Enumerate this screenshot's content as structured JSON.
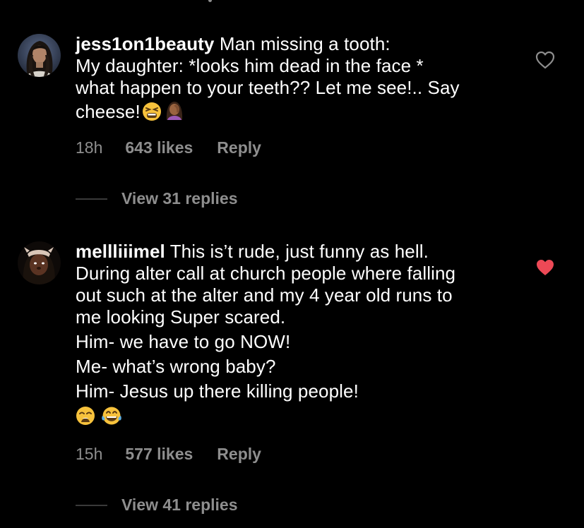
{
  "colors": {
    "background": "#000000",
    "text": "#ffffff",
    "secondary_text": "#8e8e8e",
    "like_active": "#ed4956"
  },
  "comments": [
    {
      "username": "jess1on1beauty",
      "lines": [
        "Man missing a tooth:",
        "My daughter: *looks him dead in the face *",
        "what happen to your teeth?? Let me see!.. Say",
        "cheese!"
      ],
      "emojis": [
        "tired-face-emoji",
        "woman-facepalming-emoji"
      ],
      "time": "18h",
      "likes": "643 likes",
      "reply_label": "Reply",
      "view_replies": "View 31 replies",
      "liked": false,
      "icon": "heart-outline-icon"
    },
    {
      "username": "mellliiimel",
      "lines": [
        "This is’t rude, just funny as hell.",
        "During alter call at church people where falling",
        "out such at the alter and my 4 year old runs to",
        "me looking Super scared.",
        "Him- we have to go NOW!",
        "Me- what’s wrong baby?",
        "Him- Jesus up there killing people!"
      ],
      "emojis": [
        "weary-face-emoji",
        "tears-of-joy-emoji"
      ],
      "time": "15h",
      "likes": "577 likes",
      "reply_label": "Reply",
      "view_replies": "View 41 replies",
      "liked": true,
      "icon": "heart-filled-icon"
    }
  ]
}
